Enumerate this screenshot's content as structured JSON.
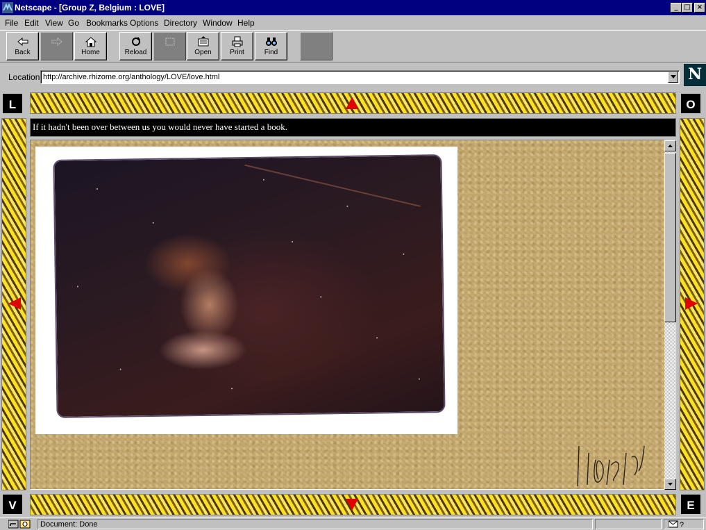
{
  "window": {
    "title": "Netscape - [Group Z, Belgium : LOVE]",
    "controls": {
      "minimize": "_",
      "maximize": "□",
      "close": "×"
    }
  },
  "menu": {
    "file": "File",
    "edit": "Edit",
    "view": "View",
    "go": "Go",
    "bookmarks": "Bookmarks",
    "options": "Options",
    "directory": "Directory",
    "window": "Window",
    "help": "Help"
  },
  "toolbar": {
    "back": "Back",
    "forward": "",
    "home": "Home",
    "reload": "Reload",
    "images": "",
    "open": "Open",
    "print": "Print",
    "find": "Find",
    "stop": ""
  },
  "location": {
    "label": "Location:",
    "url": "http://archive.rhizome.org/anthology/LOVE/love.html"
  },
  "logo": {
    "letter": "N"
  },
  "page": {
    "letters": {
      "top_left": "L",
      "top_right": "O",
      "bottom_left": "V",
      "bottom_right": "E"
    },
    "message": "If it hadn't been over between us you would never have started a book.",
    "colors": {
      "arrow": "#e00000",
      "frame_gold": "#d9b000",
      "background": "#c4a76c"
    }
  },
  "status": {
    "text": "Document: Done"
  }
}
